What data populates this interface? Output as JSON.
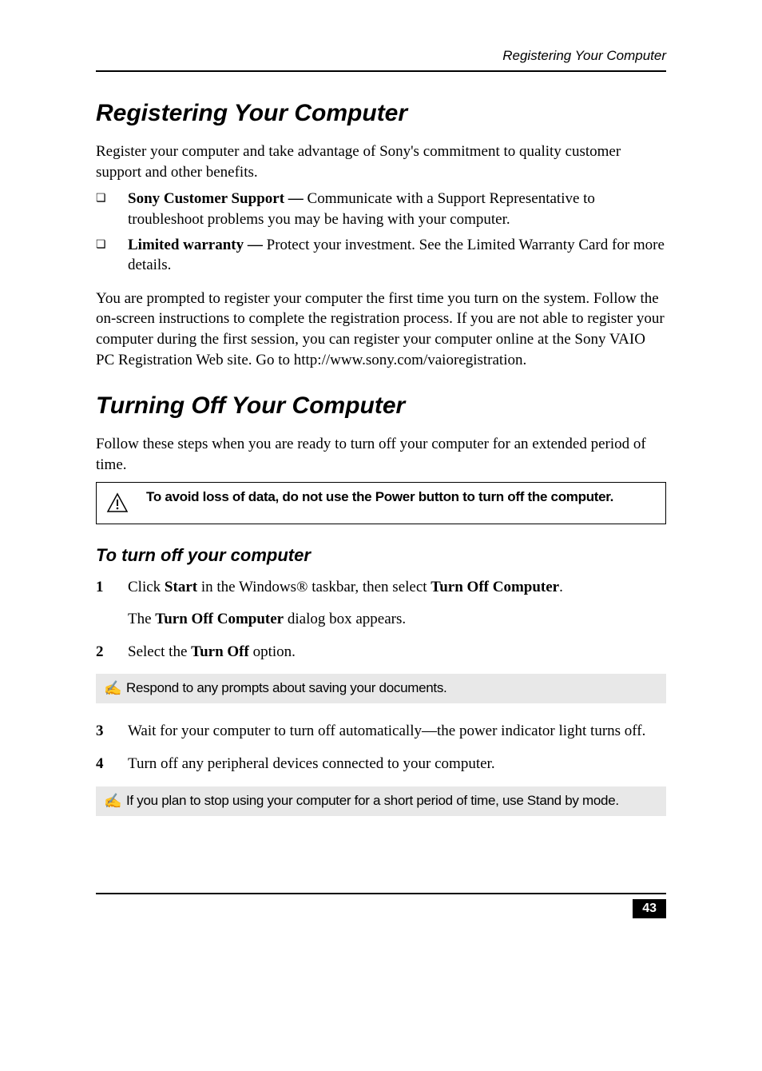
{
  "header": {
    "label": "Registering Your Computer"
  },
  "section1": {
    "title": "Registering Your Computer",
    "intro": "Register your computer and take advantage of Sony's commitment to quality customer support and other benefits.",
    "bullets": [
      {
        "bold": "Sony Customer Support — ",
        "text": "Communicate with a Support Representative to troubleshoot problems you may be having with your computer."
      },
      {
        "bold": "Limited warranty — ",
        "text": "Protect your investment. See the Limited Warranty Card for more details."
      }
    ],
    "paragraph": "You are prompted to register your computer the first time you turn on the system. Follow the on-screen instructions to complete the registration process. If you are not able to register your computer during the first session, you can register your computer online at the Sony VAIO PC Registration Web site. Go to http://www.sony.com/vaioregistration."
  },
  "section2": {
    "title": "Turning Off Your Computer",
    "intro": "Follow these steps when you are ready to turn off your computer for an extended period of time.",
    "warning": "To avoid loss of data, do not use the Power button to turn off the computer."
  },
  "subsection": {
    "title": "To turn off your computer",
    "step1_a": "Click ",
    "step1_b": "Start",
    "step1_c": " in the Windows® taskbar, then select ",
    "step1_d": "Turn Off Computer",
    "step1_e": ".",
    "step1_sub_a": "The ",
    "step1_sub_b": "Turn Off Computer",
    "step1_sub_c": " dialog box appears.",
    "step2_a": "Select the ",
    "step2_b": "Turn Off",
    "step2_c": " option.",
    "note1": "Respond to any prompts about saving your documents.",
    "step3": "Wait for your computer to turn off automatically—the power indicator light turns off.",
    "step4": "Turn off any peripheral devices connected to your computer.",
    "note2": "If you plan to stop using your computer for a short period of time, use Stand by mode."
  },
  "footer": {
    "page": "43"
  }
}
